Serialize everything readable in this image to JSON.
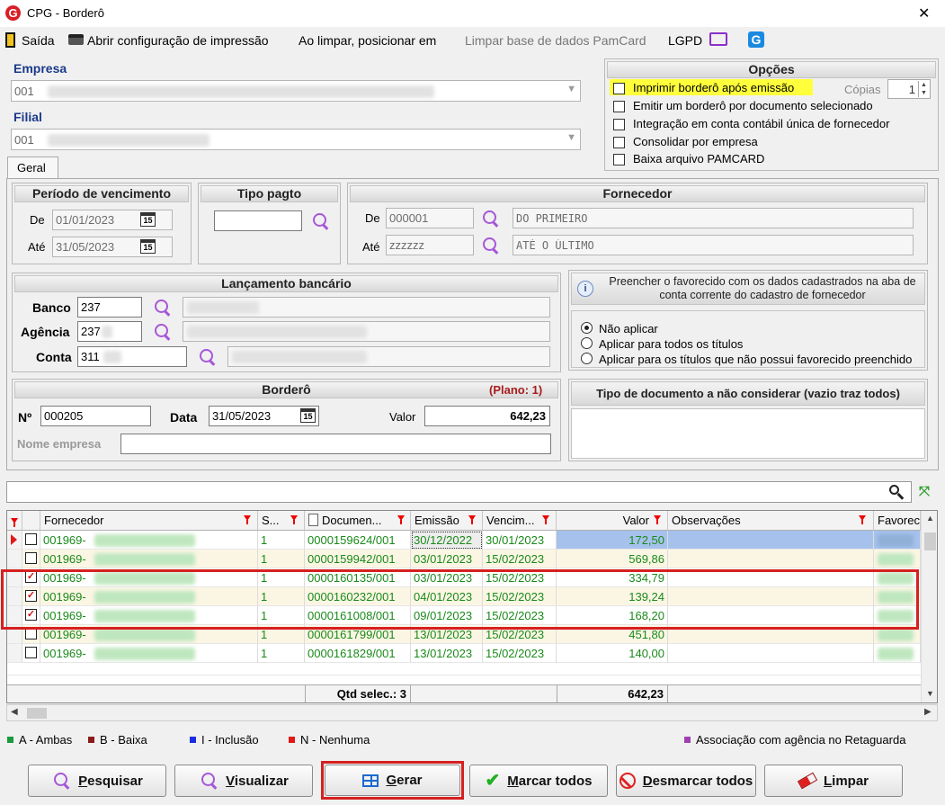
{
  "window": {
    "title": "CPG - Borderô",
    "close": "✕"
  },
  "toolbar": {
    "saida": "Saída",
    "abrir_config": "Abrir configuração de impressão",
    "ao_limpar": "Ao limpar, posicionar em",
    "limpar_base": "Limpar base de dados PamCard",
    "lgpd": "LGPD"
  },
  "empresa": {
    "label": "Empresa",
    "value": "001"
  },
  "filial": {
    "label": "Filial",
    "value": "001"
  },
  "opcoes": {
    "title": "Opções",
    "items": [
      {
        "label": "Imprimir borderô após emissão",
        "checked": false
      },
      {
        "label": "Emitir um borderô por documento selecionado",
        "checked": false
      },
      {
        "label": "Integração em conta contábil única de fornecedor",
        "checked": false
      },
      {
        "label": "Consolidar por empresa",
        "checked": false
      },
      {
        "label": "Baixa arquivo PAMCARD",
        "checked": false
      }
    ],
    "copias_label": "Cópias",
    "copias_value": "1"
  },
  "tab": {
    "label": "Geral"
  },
  "periodo": {
    "title": "Período de vencimento",
    "de_label": "De",
    "de_value": "01/01/2023",
    "ate_label": "Até",
    "ate_value": "31/05/2023",
    "cal": "15"
  },
  "tipo_pagto": {
    "title": "Tipo pagto",
    "value": ""
  },
  "fornecedor": {
    "title": "Fornecedor",
    "de_label": "De",
    "de_code": "000001",
    "de_name": "DO PRIMEIRO",
    "ate_label": "Até",
    "ate_code": "zzzzzz",
    "ate_name": "ATÉ O ÚLTIMO"
  },
  "lancamento": {
    "title": "Lançamento bancário",
    "banco_label": "Banco",
    "banco_value": "237",
    "agencia_label": "Agência",
    "agencia_value": "237",
    "conta_label": "Conta",
    "conta_value": "311"
  },
  "favorecido": {
    "text": "Preencher o favorecido com os dados cadastrados na aba de conta corrente do cadastro de fornecedor",
    "options": [
      "Não aplicar",
      "Aplicar para todos os títulos",
      "Aplicar para os títulos que não possui favorecido preenchido"
    ],
    "selected": 0
  },
  "bordero": {
    "title": "Borderô",
    "plano": "(Plano: 1)",
    "num_label": "Nº",
    "num_value": "000205",
    "data_label": "Data",
    "data_value": "31/05/2023",
    "valor_label": "Valor",
    "valor_value": "642,23",
    "nome_label": "Nome empresa",
    "nome_value": ""
  },
  "tipo_doc": {
    "title": "Tipo de documento a não considerar (vazio traz todos)"
  },
  "grid": {
    "headers": {
      "fornecedor": "Fornecedor",
      "s": "S...",
      "documento": "Documen...",
      "emissao": "Emissão",
      "vencimento": "Vencim...",
      "valor": "Valor",
      "observacoes": "Observações",
      "favorecido": "Favorec"
    },
    "rows": [
      {
        "checked": false,
        "fornecedor": "001969-",
        "s": "1",
        "documento": "0000159624/001",
        "emissao": "30/12/2022",
        "vencimento": "30/01/2023",
        "valor": "172,50",
        "current": true
      },
      {
        "checked": false,
        "fornecedor": "001969-",
        "s": "1",
        "documento": "0000159942/001",
        "emissao": "03/01/2023",
        "vencimento": "15/02/2023",
        "valor": "569,86"
      },
      {
        "checked": true,
        "fornecedor": "001969-",
        "s": "1",
        "documento": "0000160135/001",
        "emissao": "03/01/2023",
        "vencimento": "15/02/2023",
        "valor": "334,79"
      },
      {
        "checked": true,
        "fornecedor": "001969-",
        "s": "1",
        "documento": "0000160232/001",
        "emissao": "04/01/2023",
        "vencimento": "15/02/2023",
        "valor": "139,24"
      },
      {
        "checked": true,
        "fornecedor": "001969-",
        "s": "1",
        "documento": "0000161008/001",
        "emissao": "09/01/2023",
        "vencimento": "15/02/2023",
        "valor": "168,20"
      },
      {
        "checked": false,
        "fornecedor": "001969-",
        "s": "1",
        "documento": "0000161799/001",
        "emissao": "13/01/2023",
        "vencimento": "15/02/2023",
        "valor": "451,80"
      },
      {
        "checked": false,
        "fornecedor": "001969-",
        "s": "1",
        "documento": "0000161829/001",
        "emissao": "13/01/2023",
        "vencimento": "15/02/2023",
        "valor": "140,00"
      }
    ],
    "footer": {
      "qtd_label": "Qtd selec.: 3",
      "total": "642,23"
    }
  },
  "legend": [
    {
      "label": "A - Ambas",
      "color": "#1a9a3a"
    },
    {
      "label": "B - Baixa",
      "color": "#8b1a1a"
    },
    {
      "label": "I - Inclusão",
      "color": "#1a2ee0"
    },
    {
      "label": "N - Nenhuma",
      "color": "#e01a1a"
    }
  ],
  "legend_right": {
    "label": "Associação com agência no Retaguarda",
    "color": "#a040b0"
  },
  "buttons": {
    "pesquisar": {
      "key": "P",
      "rest": "esquisar"
    },
    "visualizar": {
      "key": "V",
      "rest": "isualizar"
    },
    "gerar": {
      "key": "G",
      "rest": "erar"
    },
    "marcar": {
      "key": "M",
      "rest": "arcar todos"
    },
    "desmarcar": {
      "key": "D",
      "rest": "esmarcar todos"
    },
    "limpar": {
      "key": "L",
      "rest": "impar"
    }
  },
  "colors": {
    "accent_green": "#1a8a1a",
    "highlight_red": "#d62020",
    "highlight_yellow": "#ffff3c",
    "selected_row": "#a6c2ec"
  }
}
